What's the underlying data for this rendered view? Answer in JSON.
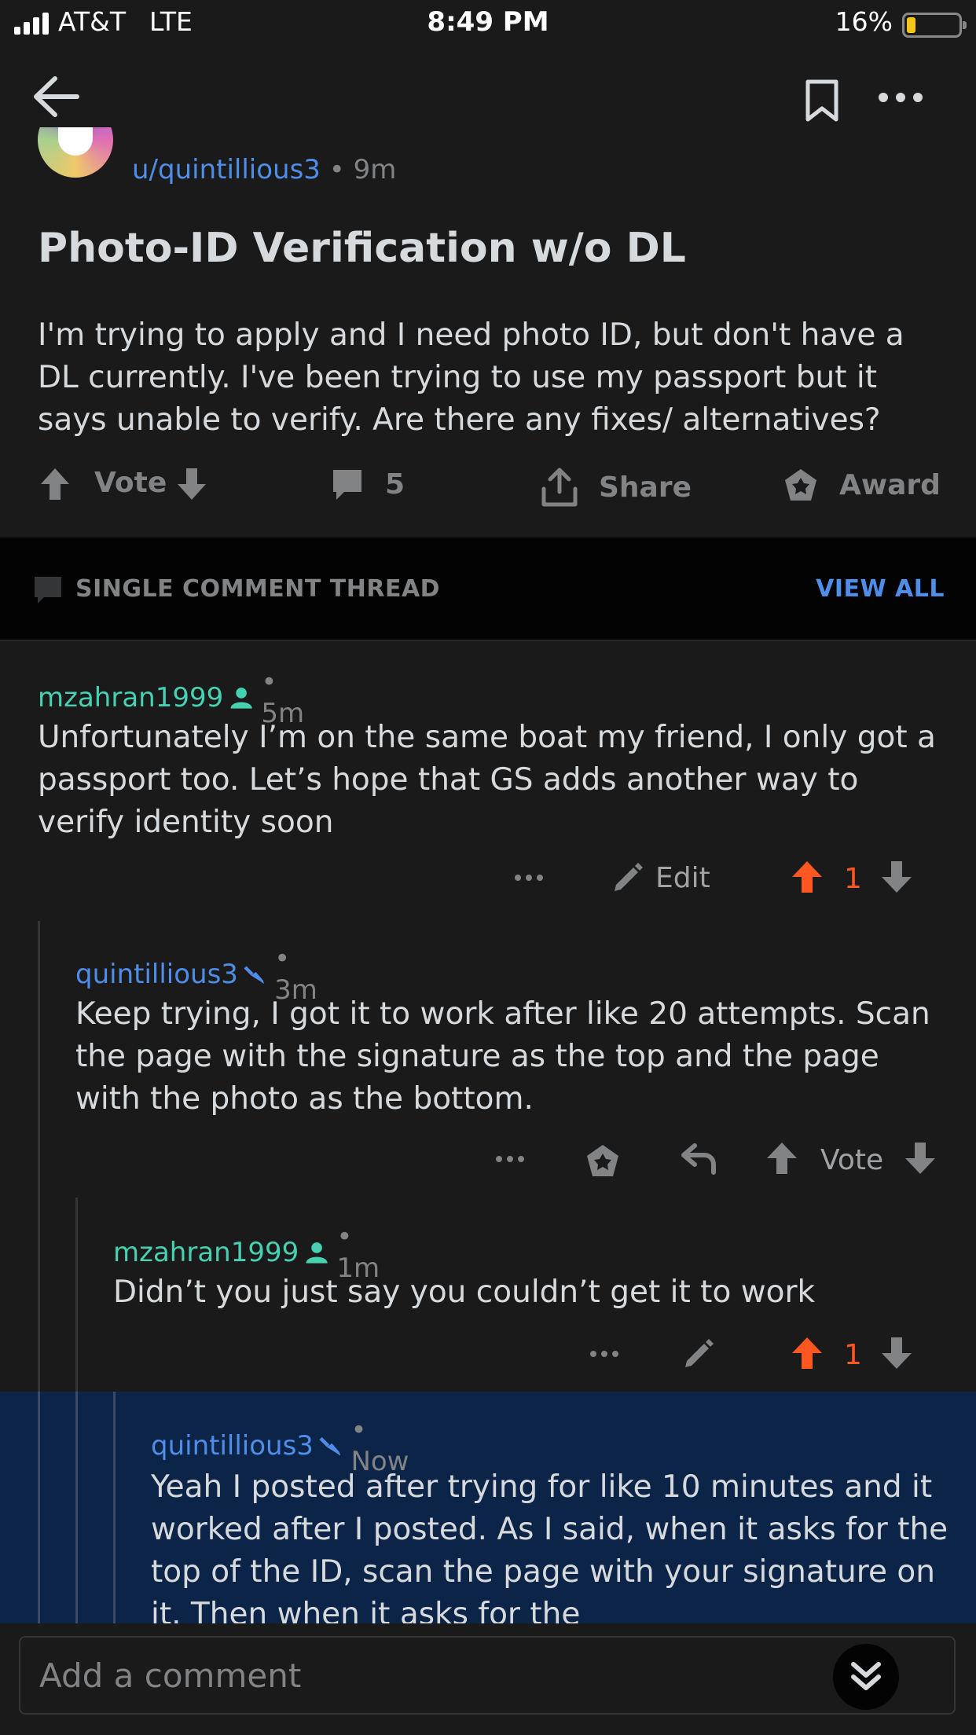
{
  "status": {
    "carrier": "AT&T",
    "network": "LTE",
    "time": "8:49 PM",
    "battery": "16%",
    "battery_level": 0.16
  },
  "post": {
    "author": "u/quintillious3",
    "age": "• 9m",
    "title": "Photo-ID Verification w/o DL",
    "body": "I'm trying to apply and I need photo ID, but don't have a DL currently. I've been trying to use my passport but it says unable to verify. Are there any fixes/ alternatives?",
    "vote_label": "Vote",
    "comment_count": "5",
    "share_label": "Share",
    "award_label": "Award"
  },
  "thread_bar": {
    "label": "SINGLE COMMENT THREAD",
    "view_all": "VIEW ALL"
  },
  "comments": [
    {
      "author": "mzahran1999",
      "age": "• 5m",
      "body": "Unfortunately I’m on the same boat my friend, I only got a passport too. Let’s hope that GS adds another way to verify identity soon",
      "edit_label": "Edit",
      "score": "1"
    },
    {
      "author": "quintillious3",
      "age": "• 3m",
      "body": "Keep trying, I got it to work after like 20 attempts. Scan the page with the signature as the top and the page with the photo as the bottom.",
      "vote_label": "Vote"
    },
    {
      "author": "mzahran1999",
      "age": "• 1m",
      "body": "Didn’t you just say you couldn’t get it to work",
      "score": "1"
    },
    {
      "author": "quintillious3",
      "age": "• Now",
      "body": "Yeah I posted after trying for like 10 minutes and it worked after I posted. As I said, when it asks for the top of the ID, scan the page with your signature on it. Then when it asks for the"
    }
  ],
  "composer": {
    "placeholder": "Add a comment"
  },
  "colors": {
    "background": "#1a1a1b",
    "accent_blue": "#4f8ee8",
    "op_green": "#46d1b1",
    "upvote_orange": "#ff5722",
    "highlight": "#0c2447"
  }
}
